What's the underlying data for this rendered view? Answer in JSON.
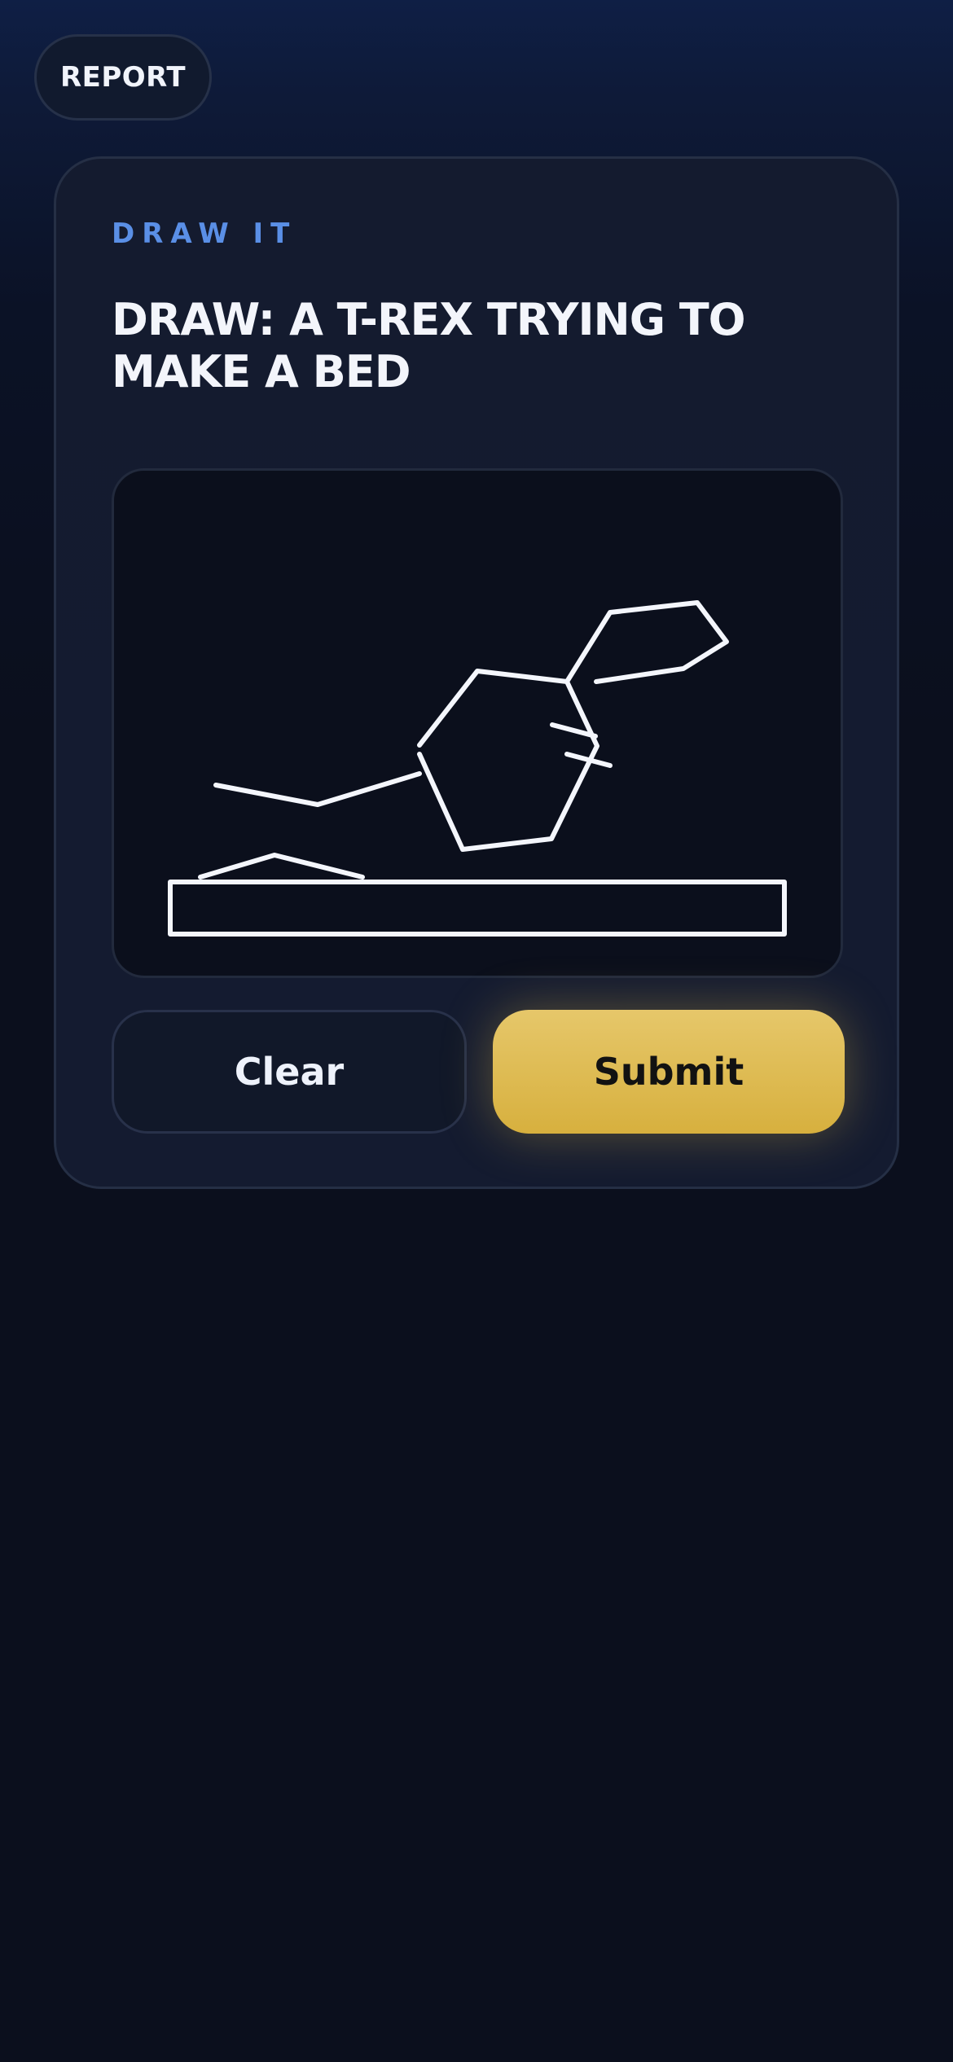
{
  "header": {
    "report_label": "REPORT"
  },
  "card": {
    "eyebrow": "DRAW IT",
    "prompt": "DRAW: A T-REX TRYING TO MAKE A BED"
  },
  "actions": {
    "clear_label": "Clear",
    "submit_label": "Submit"
  },
  "colors": {
    "accent": "#5a8fe6",
    "submit": "#e0bd52",
    "stroke": "#f4f6fc",
    "background": "#0b0f1d"
  }
}
